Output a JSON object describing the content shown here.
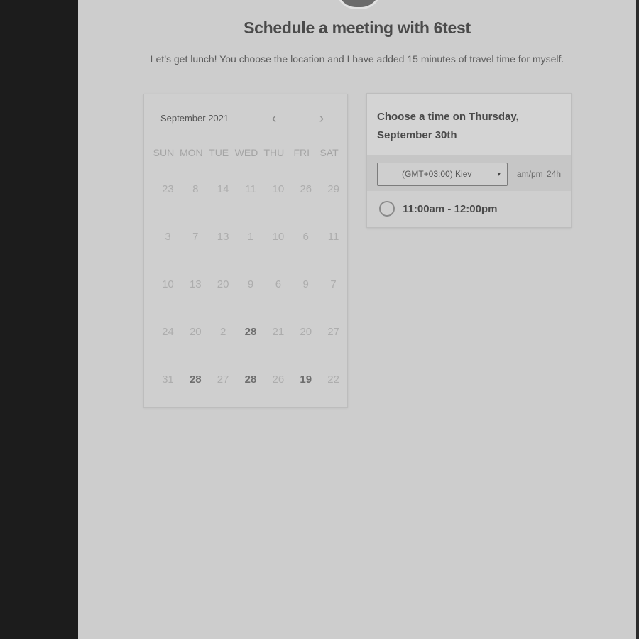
{
  "header": {
    "title": "Schedule a meeting with 6test",
    "subtitle": "Let’s get lunch! You choose the location and I have added 15 minutes of travel time for myself."
  },
  "calendar": {
    "month_label": "September 2021",
    "prev_icon": "‹",
    "next_icon": "›",
    "weekdays": [
      "SUN",
      "MON",
      "TUE",
      "WED",
      "THU",
      "FRI",
      "SAT"
    ],
    "weeks": [
      [
        {
          "d": "23",
          "active": false
        },
        {
          "d": "8",
          "active": false
        },
        {
          "d": "14",
          "active": false
        },
        {
          "d": "11",
          "active": false
        },
        {
          "d": "10",
          "active": false
        },
        {
          "d": "26",
          "active": false
        },
        {
          "d": "29",
          "active": false
        }
      ],
      [
        {
          "d": "3",
          "active": false
        },
        {
          "d": "7",
          "active": false
        },
        {
          "d": "13",
          "active": false
        },
        {
          "d": "1",
          "active": false
        },
        {
          "d": "10",
          "active": false
        },
        {
          "d": "6",
          "active": false
        },
        {
          "d": "11",
          "active": false
        }
      ],
      [
        {
          "d": "10",
          "active": false
        },
        {
          "d": "13",
          "active": false
        },
        {
          "d": "20",
          "active": false
        },
        {
          "d": "9",
          "active": false
        },
        {
          "d": "6",
          "active": false
        },
        {
          "d": "9",
          "active": false
        },
        {
          "d": "7",
          "active": false
        }
      ],
      [
        {
          "d": "24",
          "active": false
        },
        {
          "d": "20",
          "active": false
        },
        {
          "d": "2",
          "active": false
        },
        {
          "d": "28",
          "active": true
        },
        {
          "d": "21",
          "active": false
        },
        {
          "d": "20",
          "active": false
        },
        {
          "d": "27",
          "active": false
        }
      ],
      [
        {
          "d": "31",
          "active": false
        },
        {
          "d": "28",
          "active": true
        },
        {
          "d": "27",
          "active": false
        },
        {
          "d": "28",
          "active": true
        },
        {
          "d": "26",
          "active": false
        },
        {
          "d": "19",
          "active": true
        },
        {
          "d": "22",
          "active": false
        }
      ]
    ]
  },
  "time_panel": {
    "heading": "Choose a time on Thursday, September 30th",
    "timezone": "(GMT+03:00) Kiev",
    "timezone_caret": "▾",
    "format_ampm": "am/pm",
    "format_24h": "24h",
    "slots": [
      {
        "label": "11:00am - 12:00pm"
      }
    ]
  },
  "colors": {
    "page_bg": "#cdcdcd",
    "outer_bg": "#1c1c1c",
    "text_dark": "#4a4a4a",
    "text_muted": "#adadad"
  }
}
